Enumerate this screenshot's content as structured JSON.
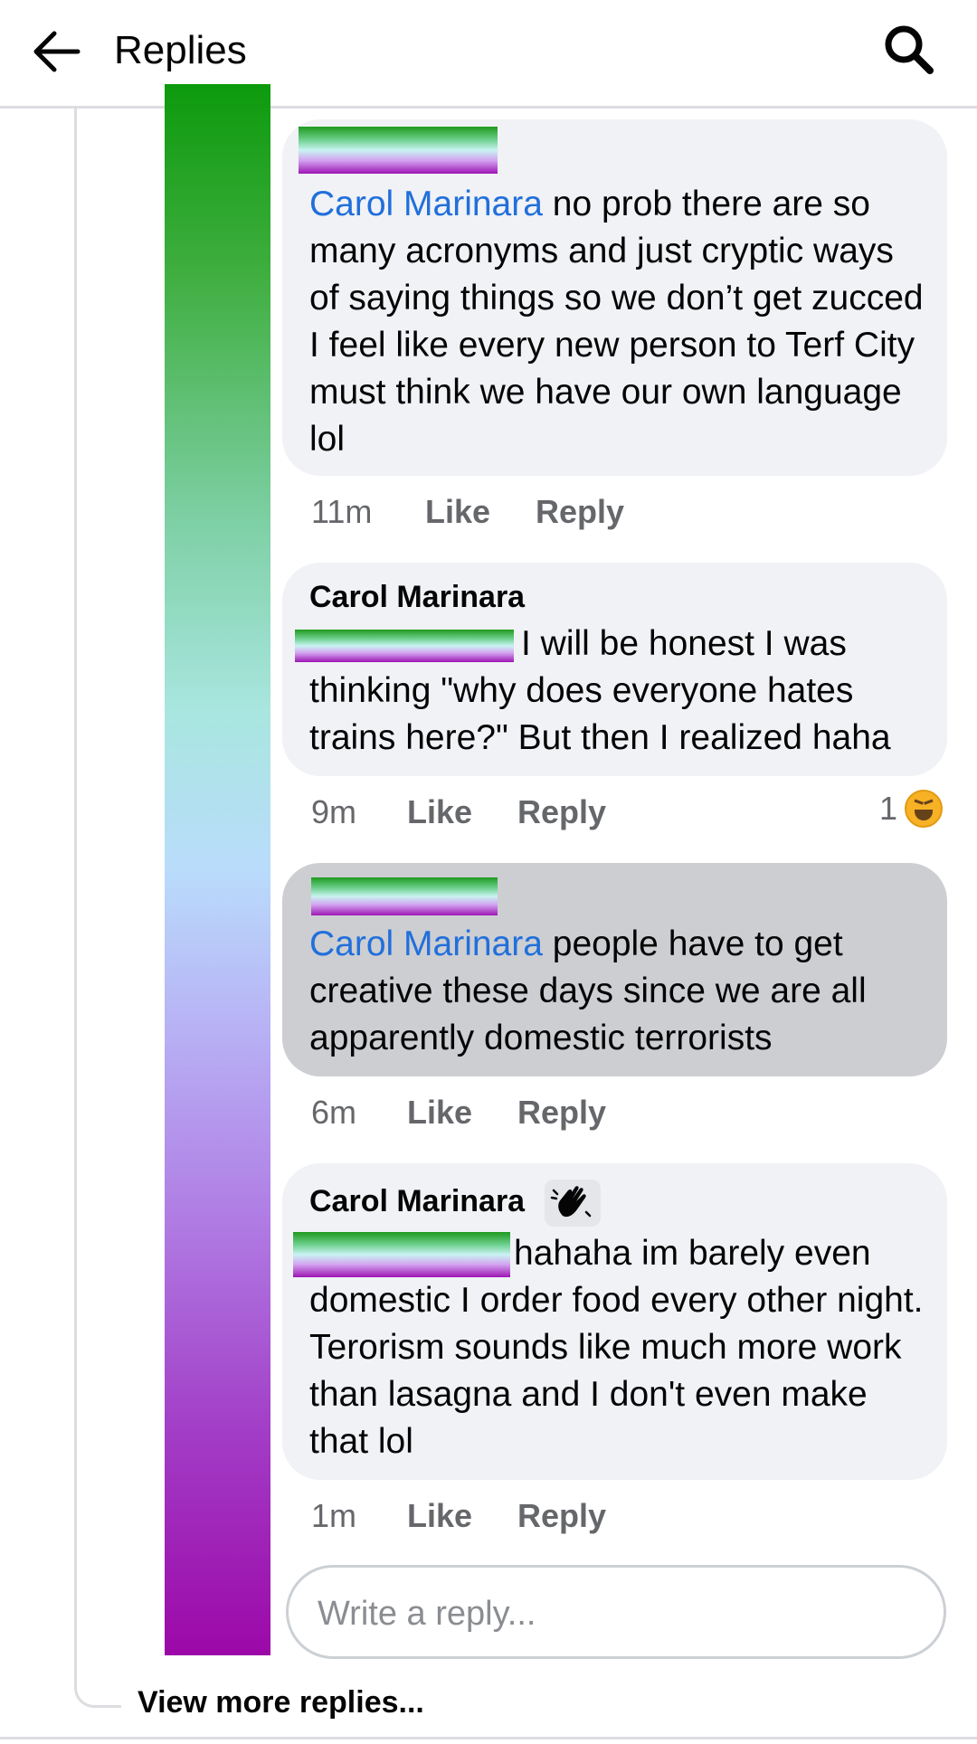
{
  "header": {
    "title": "Replies",
    "back_icon": "arrow-left-icon",
    "search_icon": "search-icon"
  },
  "comments": [
    {
      "mention": "Carol Marinara",
      "text": " no prob there are so many acronyms and just cryptic ways of saying things so we don’t get zucced I feel like every new person to Terf City must think we have our own language lol",
      "time": "11m",
      "like": "Like",
      "reply": "Reply"
    },
    {
      "author": "Carol Marinara",
      "text": "I will be honest I was thinking \"why does everyone hates trains here?\" But then I realized haha",
      "time": "9m",
      "like": "Like",
      "reply": "Reply",
      "reaction_count": "1",
      "reaction_icon": "laughing-emoji-icon"
    },
    {
      "mention": "Carol Marinara",
      "text": " people have to get creative these days since we are all apparently domestic terrorists",
      "time": "6m",
      "like": "Like",
      "reply": "Reply",
      "highlighted": true
    },
    {
      "author": "Carol Marinara",
      "author_badge_icon": "waving-hand-icon",
      "text": "hahaha im barely even domestic I order food every other night. Terorism sounds like much more work than lasagna and I don't even make that lol",
      "time": "1m",
      "like": "Like",
      "reply": "Reply"
    }
  ],
  "reply_input": {
    "placeholder": "Write a reply..."
  },
  "view_more": "View more replies..."
}
